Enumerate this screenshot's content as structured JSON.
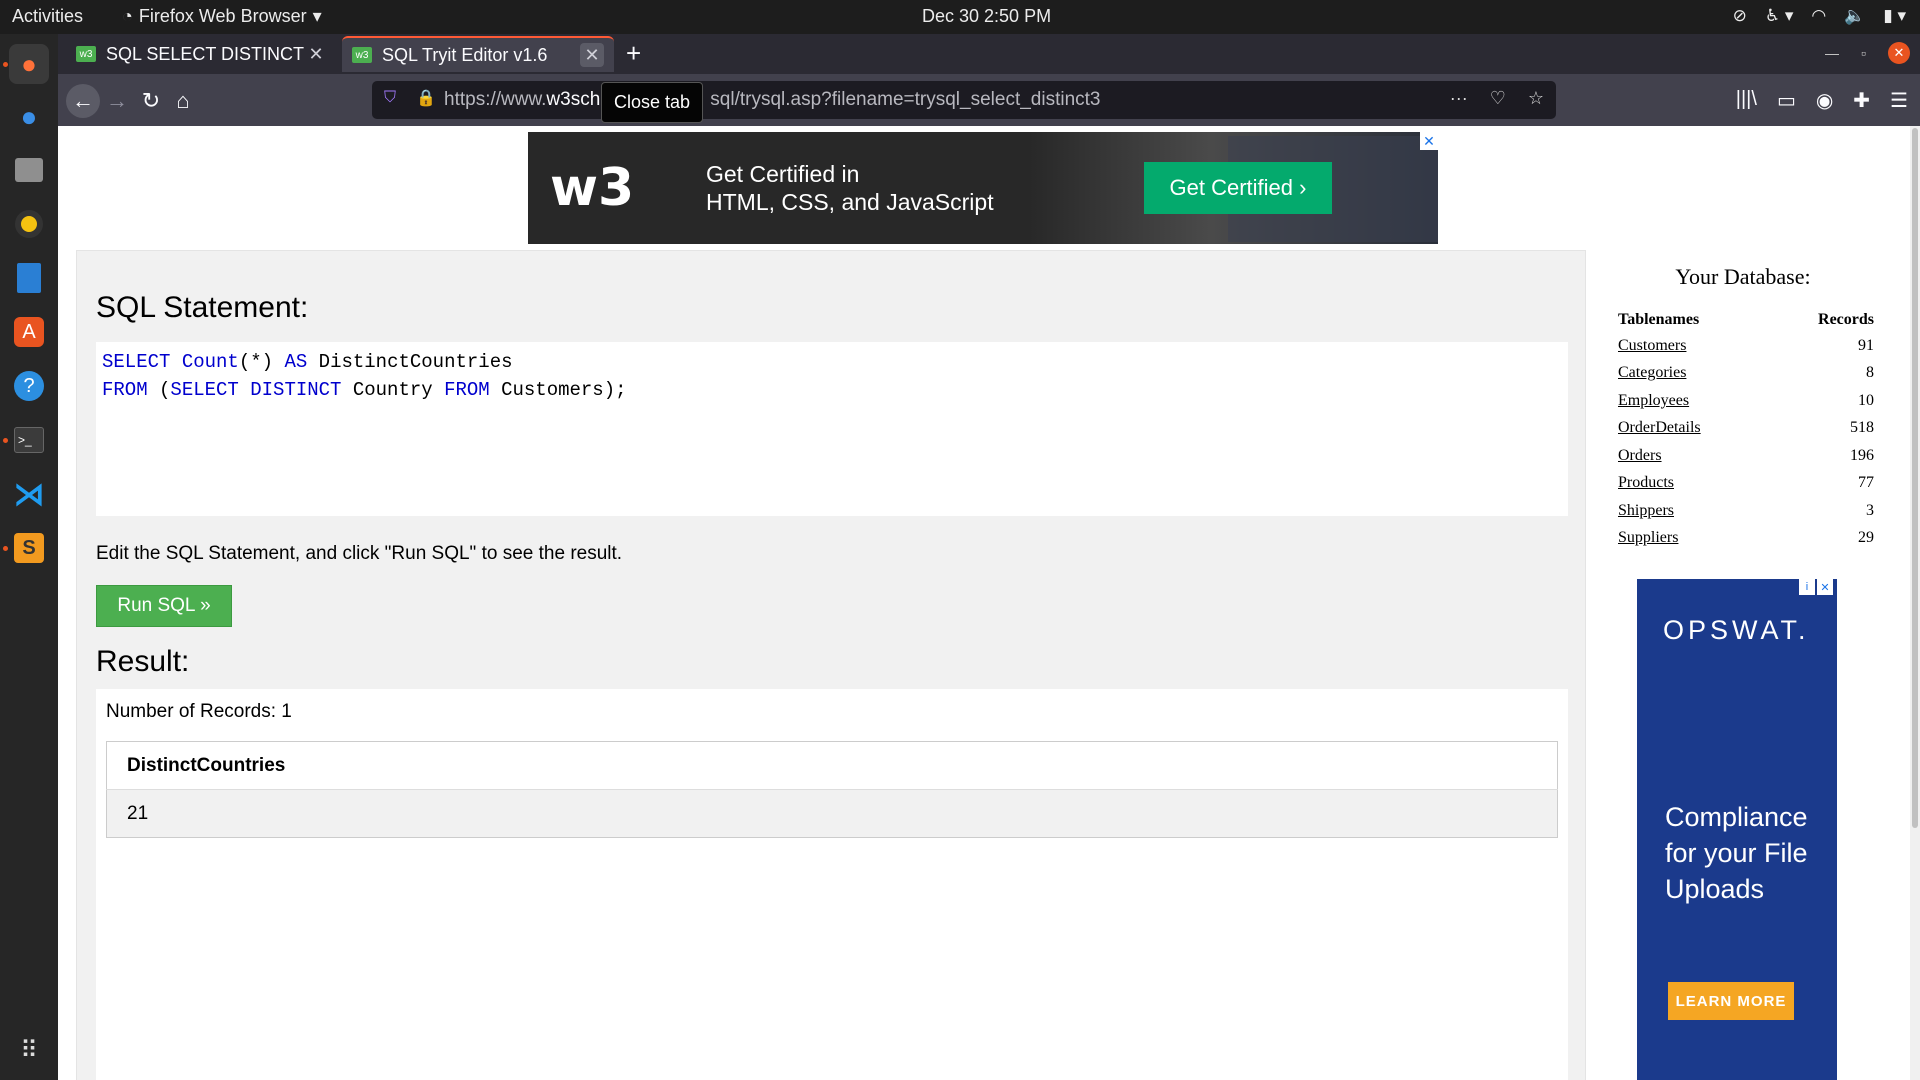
{
  "system": {
    "activities": "Activities",
    "app_menu": "Firefox Web Browser",
    "clock": "Dec 30  2:50 PM"
  },
  "browser": {
    "tabs": [
      {
        "label": "SQL SELECT DISTINCT St",
        "active": false
      },
      {
        "label": "SQL Tryit Editor v1.6",
        "active": true
      }
    ],
    "url_prefix": "https://www.",
    "url_domain": "w3sch",
    "url_rest": "sql/trysql.asp?filename=trysql_select_distinct3",
    "tooltip": "Close tab"
  },
  "banner_ad": {
    "logo": "w3",
    "line1": "Get Certified in",
    "line2": "HTML, CSS, and JavaScript",
    "cta": "Get Certified ›"
  },
  "editor": {
    "heading": "SQL Statement:",
    "line1": [
      {
        "t": "SELECT ",
        "k": true
      },
      {
        "t": "Count",
        "k": true
      },
      {
        "t": "(*) ",
        "k": false
      },
      {
        "t": "AS",
        "k": true
      },
      {
        "t": " DistinctCountries",
        "k": false
      }
    ],
    "line2": [
      {
        "t": "FROM",
        "k": true
      },
      {
        "t": " (",
        "k": false
      },
      {
        "t": "SELECT DISTINCT",
        "k": true
      },
      {
        "t": " Country ",
        "k": false
      },
      {
        "t": "FROM",
        "k": true
      },
      {
        "t": " Customers);",
        "k": false
      }
    ],
    "hint": "Edit the SQL Statement, and click \"Run SQL\" to see the result.",
    "run_label": "Run SQL »"
  },
  "result": {
    "heading": "Result:",
    "count_text": "Number of Records: 1",
    "column": "DistinctCountries",
    "value": "21"
  },
  "database": {
    "heading": "Your Database:",
    "col_name": "Tablenames",
    "col_records": "Records",
    "tables": [
      {
        "name": "Customers",
        "records": "91"
      },
      {
        "name": "Categories",
        "records": "8"
      },
      {
        "name": "Employees",
        "records": "10"
      },
      {
        "name": "OrderDetails",
        "records": "518"
      },
      {
        "name": "Orders",
        "records": "196"
      },
      {
        "name": "Products",
        "records": "77"
      },
      {
        "name": "Shippers",
        "records": "3"
      },
      {
        "name": "Suppliers",
        "records": "29"
      }
    ]
  },
  "side_ad": {
    "brand": "OPSWAT.",
    "headline": "Compliance for your File Uploads",
    "cta": "LEARN MORE"
  },
  "colors": {
    "run_button": "#4caf50",
    "keyword": "#0000cd",
    "cta_green": "#04aa6d"
  }
}
